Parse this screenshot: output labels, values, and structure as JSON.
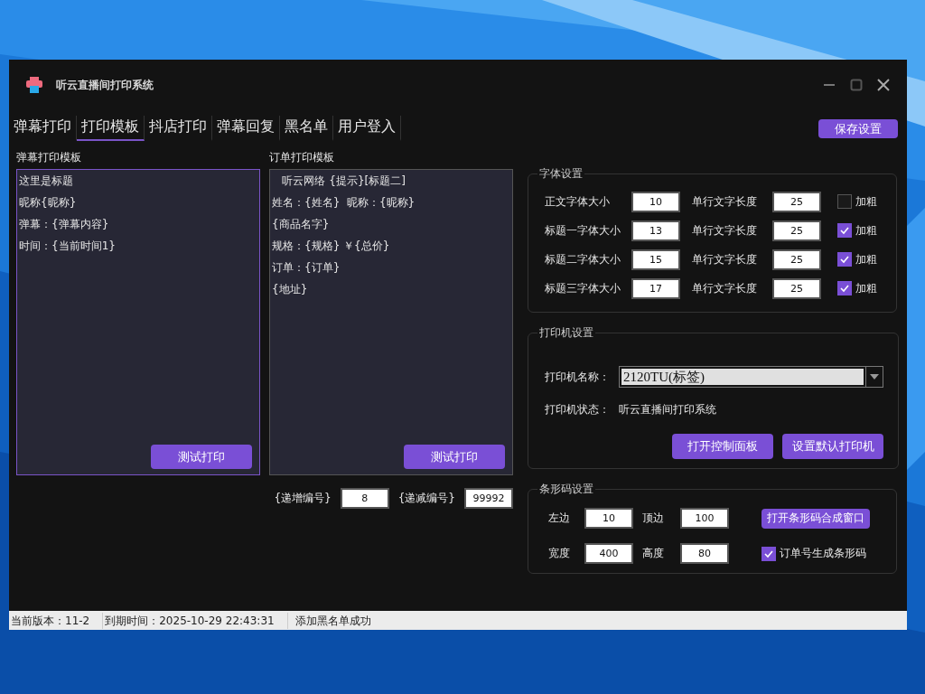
{
  "window": {
    "title": "听云直播间打印系统"
  },
  "tabs": [
    {
      "label": "弹幕打印",
      "selected": false
    },
    {
      "label": "打印模板",
      "selected": true
    },
    {
      "label": "抖店打印",
      "selected": false
    },
    {
      "label": "弹幕回复",
      "selected": false
    },
    {
      "label": "黑名单",
      "selected": false
    },
    {
      "label": "用户登入",
      "selected": false
    }
  ],
  "save_button": "保存设置",
  "templates": [
    {
      "title": "弹幕打印模板",
      "focused": true,
      "lines": [
        "这里是标题",
        "昵称{昵称}",
        "弹幕：{弹幕内容}",
        "时间：{当前时间1}"
      ],
      "button": "测试打印"
    },
    {
      "title": "订单打印模板",
      "focused": false,
      "lines": [
        "   听云网络 {提示}[标题二]",
        "姓名：{姓名}  昵称：{昵称}",
        "{商品名字}",
        "规格：{规格} ￥{总价}",
        "订单：{订单}",
        "{地址}"
      ],
      "button": "测试打印"
    }
  ],
  "counters": [
    {
      "label": "{递增编号}",
      "value": "8"
    },
    {
      "label": "{递减编号}",
      "value": "99992"
    }
  ],
  "font_settings": {
    "title": "字体设置",
    "rows": [
      {
        "label": "正文字体大小",
        "size": "10",
        "length_label": "单行文字长度",
        "length": "25",
        "bold_label": "加粗",
        "checked": false
      },
      {
        "label": "标题一字体大小",
        "size": "13",
        "length_label": "单行文字长度",
        "length": "25",
        "bold_label": "加粗",
        "checked": true
      },
      {
        "label": "标题二字体大小",
        "size": "15",
        "length_label": "单行文字长度",
        "length": "25",
        "bold_label": "加粗",
        "checked": true
      },
      {
        "label": "标题三字体大小",
        "size": "17",
        "length_label": "单行文字长度",
        "length": "25",
        "bold_label": "加粗",
        "checked": true
      }
    ]
  },
  "printer": {
    "title": "打印机设置",
    "name_label": "打印机名称：",
    "name": "2120TU(标签)",
    "status_label": "打印机状态：",
    "status": "听云直播间打印系统",
    "buttons": [
      "打开控制面板",
      "设置默认打印机"
    ]
  },
  "barcode": {
    "title": "条形码设置",
    "fields": [
      {
        "label": "左边",
        "value": "10"
      },
      {
        "label": "顶边",
        "value": "100"
      },
      {
        "label": "宽度",
        "value": "400"
      },
      {
        "label": "高度",
        "value": "80"
      }
    ],
    "button": "打开条形码合成窗口",
    "checkbox": {
      "label": "订单号生成条形码",
      "checked": true
    }
  },
  "status_bar": [
    "当前版本：11-2",
    "到期时间：2025-10-29 22:43:31",
    "添加黑名单成功"
  ]
}
